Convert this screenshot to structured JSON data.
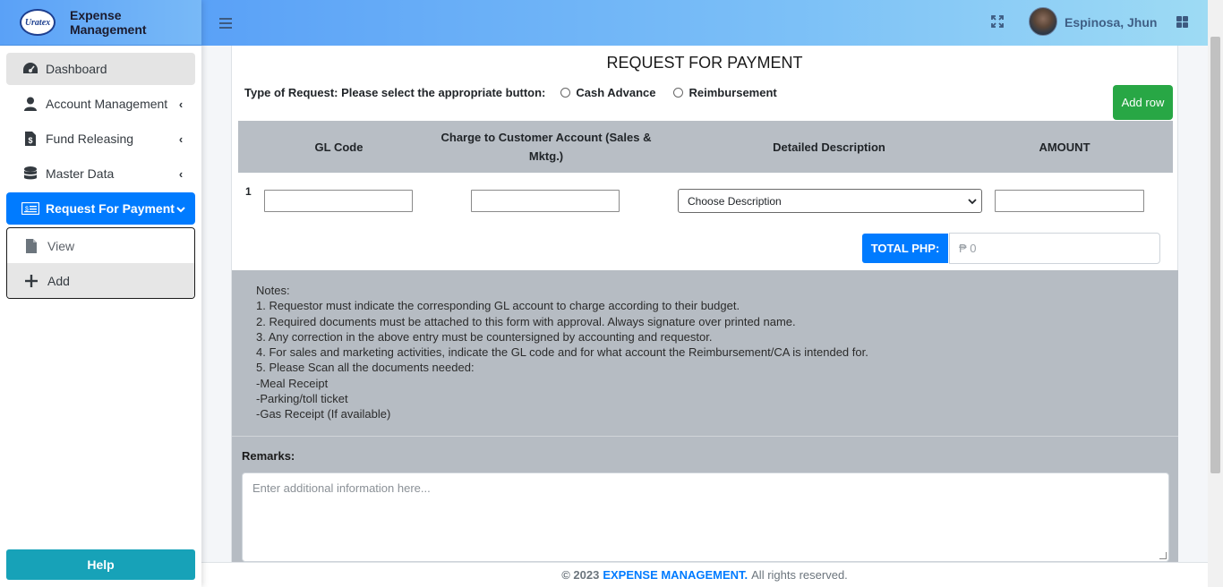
{
  "brand": {
    "logo_text": "Uratex",
    "title": "Expense Management"
  },
  "sidebar": {
    "items": [
      {
        "label": "Dashboard",
        "icon": "tachometer-icon"
      },
      {
        "label": "Account Management",
        "icon": "user-icon"
      },
      {
        "label": "Fund Releasing",
        "icon": "file-invoice-dollar-icon"
      },
      {
        "label": "Master Data",
        "icon": "database-icon"
      },
      {
        "label": "Request For Payment",
        "icon": "money-check-icon"
      }
    ],
    "submenu": [
      {
        "label": "View",
        "icon": "file-icon"
      },
      {
        "label": "Add",
        "icon": "plus-icon"
      }
    ],
    "help_label": "Help"
  },
  "header": {
    "user_name": "Espinosa, Jhun"
  },
  "form": {
    "title": "REQUEST FOR PAYMENT",
    "type_prompt": "Type of Request: Please select the appropriate button:",
    "options": [
      "Cash Advance",
      "Reimbursement"
    ],
    "add_row_label": "Add row",
    "columns": [
      "GL Code",
      "Charge to Customer Account (Sales & Mktg.)",
      "Detailed Description",
      "AMOUNT"
    ],
    "row_number": "1",
    "description_placeholder": "Choose Description",
    "total_label": "TOTAL PHP:",
    "total_value": "₱ 0"
  },
  "notes": {
    "lines": [
      "Notes:",
      "1. Requestor must indicate the corresponding GL account to charge according to their budget.",
      "2. Required documents must be attached to this form with approval. Always signature over printed name.",
      "3. Any correction in the above entry must be countersigned by accounting and requestor.",
      "4. For sales and marketing activities, indicate the GL code and for what account the Reimbursement/CA is intended for.",
      "5. Please Scan all the documents needed:",
      "-Meal Receipt",
      "-Parking/toll ticket",
      "-Gas Receipt (If available)"
    ]
  },
  "remarks": {
    "label": "Remarks:",
    "placeholder": "Enter additional information here..."
  },
  "footer": {
    "copyright": "© 2023",
    "brand": "EXPENSE MANAGEMENT.",
    "rights": "All rights reserved."
  }
}
